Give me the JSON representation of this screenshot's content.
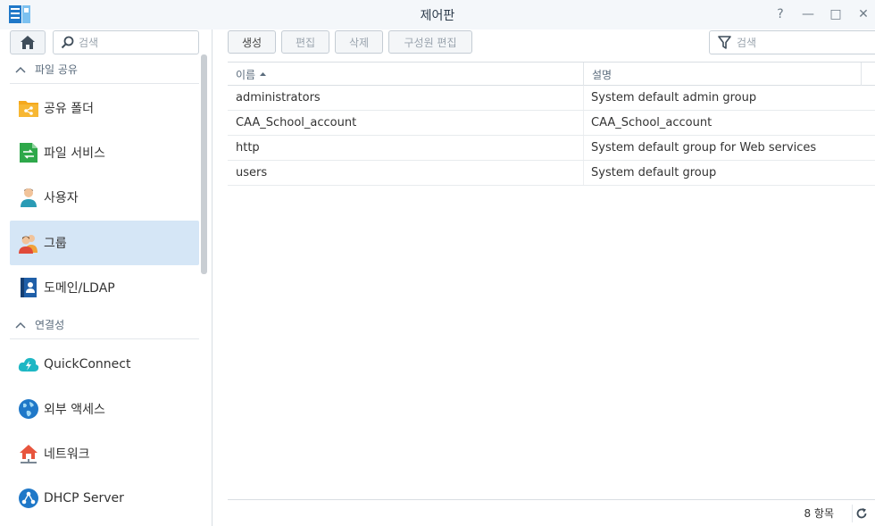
{
  "window": {
    "title": "제어판",
    "controls": [
      "?",
      "—",
      "□",
      "✕"
    ]
  },
  "sidebar": {
    "search_placeholder": "검색",
    "sections": [
      {
        "label": "파일 공유",
        "items": [
          {
            "label": "공유 폴더",
            "icon": "shared-folder-icon"
          },
          {
            "label": "파일 서비스",
            "icon": "file-services-icon"
          },
          {
            "label": "사용자",
            "icon": "user-icon"
          },
          {
            "label": "그룹",
            "icon": "group-icon",
            "active": true
          },
          {
            "label": "도메인/LDAP",
            "icon": "domain-ldap-icon"
          }
        ]
      },
      {
        "label": "연결성",
        "items": [
          {
            "label": "QuickConnect",
            "icon": "quickconnect-icon"
          },
          {
            "label": "외부 액세스",
            "icon": "external-access-icon"
          },
          {
            "label": "네트워크",
            "icon": "network-icon"
          },
          {
            "label": "DHCP Server",
            "icon": "dhcp-server-icon"
          }
        ]
      }
    ]
  },
  "toolbar": {
    "create": "생성",
    "edit": "편집",
    "delete": "삭제",
    "edit_members": "구성원 편집",
    "filter_placeholder": "검색"
  },
  "table": {
    "columns": [
      "이름",
      "설명"
    ],
    "rows": [
      [
        "administrators",
        "System default admin group"
      ],
      [
        "CAA_School_account",
        "CAA_School_account"
      ],
      [
        "http",
        "System default group for Web services"
      ],
      [
        "users",
        "System default group"
      ]
    ]
  },
  "footer": {
    "count": "8 항목"
  },
  "colors": {
    "accent": "#0086e5",
    "active_bg": "#d5e6f6"
  }
}
